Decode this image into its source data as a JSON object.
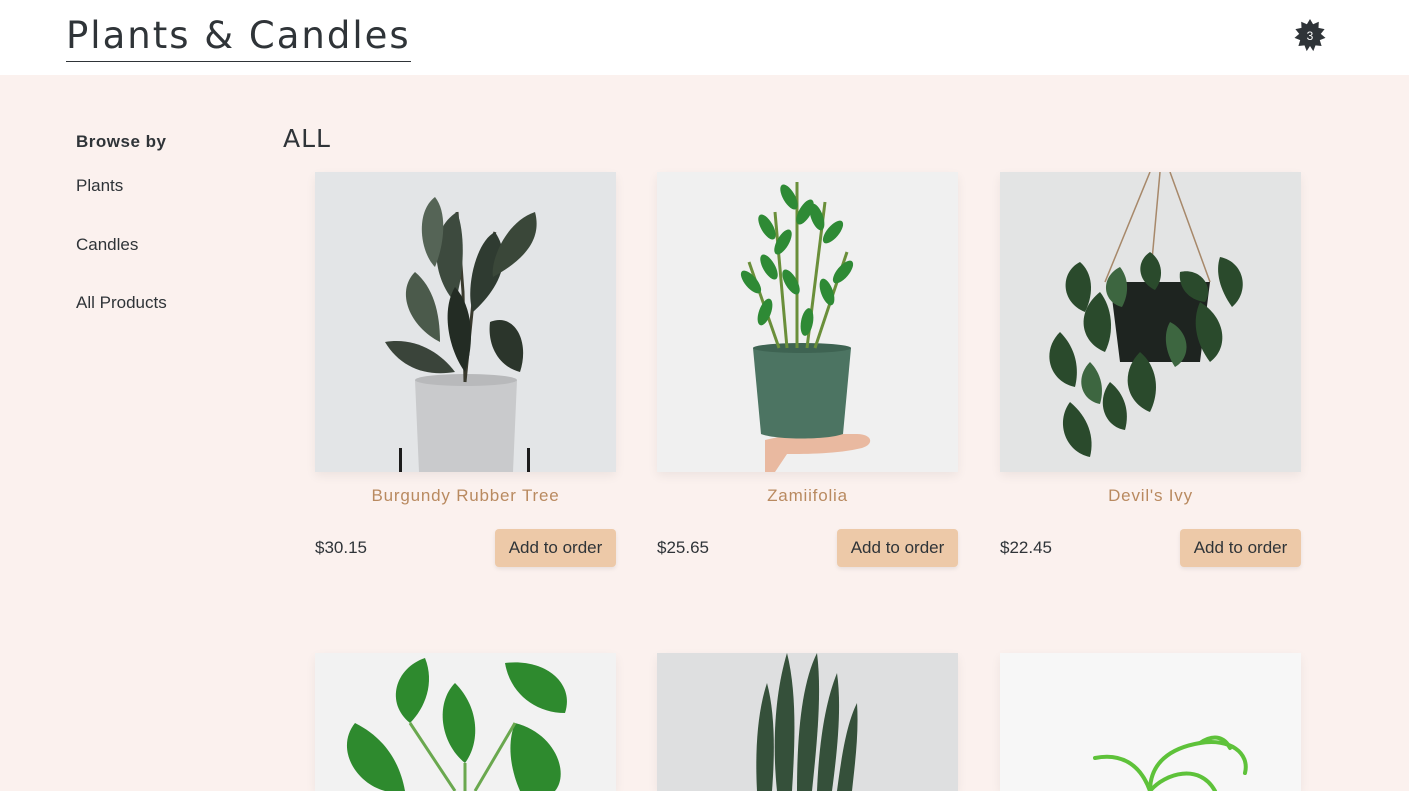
{
  "header": {
    "logo": "Plants & Candles",
    "cart_count": "3"
  },
  "sidebar": {
    "heading": "Browse by",
    "links": [
      {
        "label": "Plants"
      },
      {
        "label": "Candles"
      },
      {
        "label": "All Products"
      }
    ]
  },
  "main": {
    "title": "ALL",
    "products": [
      {
        "name": "Burgundy Rubber Tree",
        "price": "$30.15",
        "button": "Add to order"
      },
      {
        "name": "Zamiifolia",
        "price": "$25.65",
        "button": "Add to order"
      },
      {
        "name": "Devil's Ivy",
        "price": "$22.45",
        "button": "Add to order"
      }
    ]
  },
  "colors": {
    "page_bg": "#fbf1ee",
    "header_bg": "#ffffff",
    "product_name": "#b98a60",
    "button_bg": "#edc9a8",
    "cart_badge": "#2f3438"
  }
}
